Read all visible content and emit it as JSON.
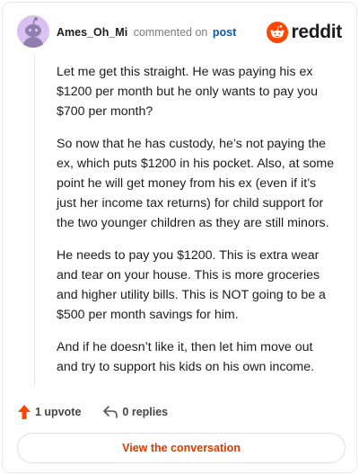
{
  "header": {
    "username": "Ames_Oh_Mi",
    "verb": "commented on",
    "post_link": "post",
    "brand": "reddit"
  },
  "comment": {
    "paragraphs": [
      "Let me get this straight. He was paying his ex $1200 per month but he only wants to pay you $700 per month?",
      "So now that he has custody, he’s not paying the ex, which puts $1200 in his pocket. Also, at some point he will get money from his ex (even if it’s just her income tax returns) for child support for the two younger children as they are still minors.",
      "He needs to pay you $1200. This is extra wear and tear on your house. This is more groceries and higher utility bills. This is NOT going to be a $500 per month savings for him.",
      "And if he doesn’t like it, then let him move out and try to support his kids on his own income."
    ]
  },
  "actions": {
    "upvote_label": "1 upvote",
    "replies_label": "0 replies"
  },
  "cta": {
    "label": "View the conversation"
  },
  "colors": {
    "reddit_orange": "#ff4500",
    "cta_text": "#d93a00",
    "link_blue": "#0d5aa7",
    "avatar_bg": "#d9c2f0"
  },
  "icons": {
    "brand": "reddit-snoo-icon",
    "upvote": "upvote-arrow-icon",
    "reply": "reply-arrow-icon"
  }
}
